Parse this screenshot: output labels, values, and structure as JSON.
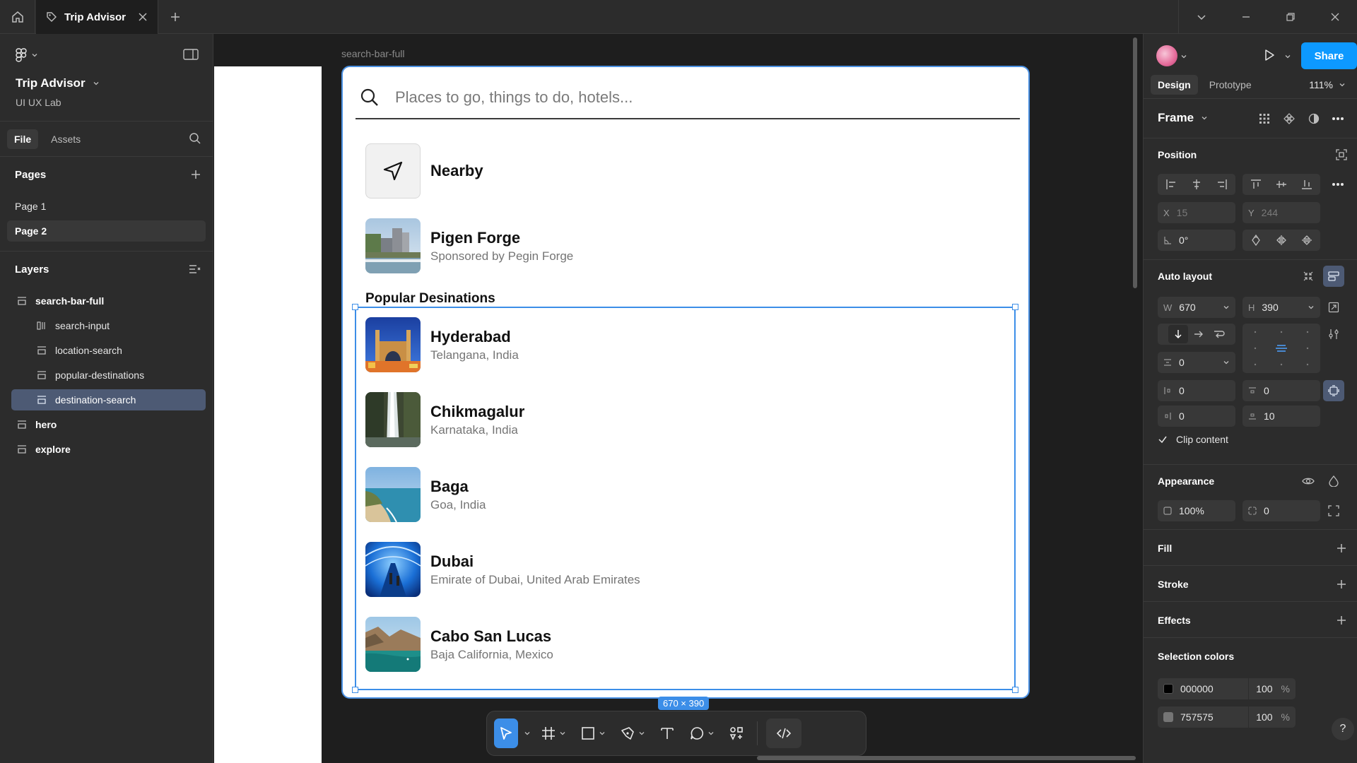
{
  "titlebar": {
    "tab_label": "Trip Advisor"
  },
  "file": {
    "title": "Trip Advisor",
    "team": "UI UX Lab",
    "tabs": [
      "File",
      "Assets"
    ]
  },
  "pages": {
    "heading": "Pages",
    "items": [
      "Page 1",
      "Page 2"
    ]
  },
  "layers": {
    "heading": "Layers",
    "items": [
      "search-bar-full",
      "search-input",
      "location-search",
      "popular-destinations",
      "destination-search",
      "hero",
      "explore"
    ]
  },
  "canvas": {
    "frame_label": "search-bar-full",
    "search_placeholder": "Places to go, things to do, hotels...",
    "nearby_label": "Nearby",
    "sponsored": {
      "title": "Pigen Forge",
      "subtitle": "Sponsored by Pegin Forge"
    },
    "popular_heading": "Popular Desinations",
    "destinations": [
      {
        "name": "Hyderabad",
        "region": "Telangana, India"
      },
      {
        "name": "Chikmagalur",
        "region": "Karnataka, India"
      },
      {
        "name": "Baga",
        "region": "Goa, India"
      },
      {
        "name": "Dubai",
        "region": "Emirate of Dubai, United Arab Emirates"
      },
      {
        "name": "Cabo San Lucas",
        "region": "Baja California, Mexico"
      }
    ],
    "dimensions_tag": "670 × 390"
  },
  "inspector": {
    "share_label": "Share",
    "tabs": [
      "Design",
      "Prototype"
    ],
    "zoom": "111%",
    "frame_label": "Frame",
    "position": {
      "heading": "Position",
      "x_label": "X",
      "x": "15",
      "y_label": "Y",
      "y": "244",
      "rotation": "0°"
    },
    "auto_layout": {
      "heading": "Auto layout",
      "w_label": "W",
      "w": "670",
      "h_label": "H",
      "h": "390",
      "gap": "0",
      "pad_left": "0",
      "pad_top": "0",
      "pad_right": "0",
      "pad_bottom": "10",
      "clip_label": "Clip content"
    },
    "appearance": {
      "heading": "Appearance",
      "opacity": "100%",
      "radius": "0"
    },
    "fill_heading": "Fill",
    "stroke_heading": "Stroke",
    "effects_heading": "Effects",
    "selection_colors": {
      "heading": "Selection colors",
      "items": [
        {
          "hex": "000000",
          "opacity": "100",
          "unit": "%",
          "swatch": "#000000"
        },
        {
          "hex": "757575",
          "opacity": "100",
          "unit": "%",
          "swatch": "#757575"
        }
      ]
    },
    "help": "?"
  },
  "colors": {
    "accent": "#0d99ff",
    "selection": "#3c8ee8",
    "panel": "#2c2c2c",
    "canvas": "#1e1e1e"
  }
}
